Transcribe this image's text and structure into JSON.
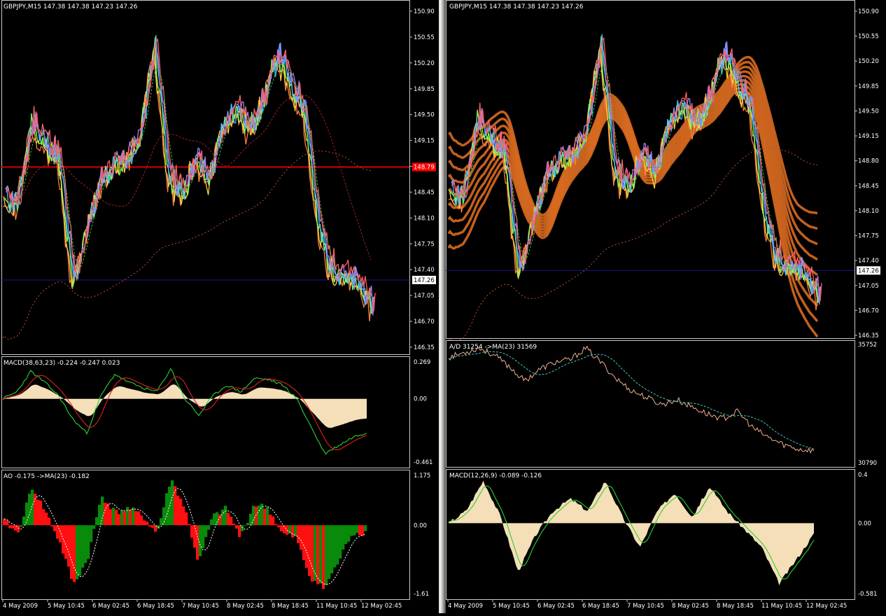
{
  "left": {
    "header": "GBPJPY,M15  147.38 147.38 147.23 147.26",
    "price_ticks": [
      "150.90",
      "150.55",
      "150.20",
      "149.85",
      "149.50",
      "149.15",
      "148.80",
      "148.45",
      "148.10",
      "147.75",
      "147.40",
      "147.05",
      "146.70",
      "146.35"
    ],
    "price_tag": "147.26",
    "level_tag": "148.79",
    "macd_header": "MACD(38,63,23) -0.224 -0.247 0.023",
    "macd_ticks": [
      "0.269",
      "0.00",
      "-0.461"
    ],
    "ao_header": "AO -0.175  ->MA(23) -0.182",
    "ao_ticks": [
      "1.175",
      "0.00",
      "-1.61"
    ],
    "time_ticks": [
      "4 May 2009",
      "5 May 10:45",
      "6 May 02:45",
      "6 May 18:45",
      "7 May 10:45",
      "8 May 02:45",
      "8 May 18:45",
      "11 May 10:45",
      "12 May 02:45"
    ]
  },
  "right": {
    "header": "GBPJPY,M15  147.38 147.38 147.23 147.26",
    "price_ticks": [
      "150.90",
      "150.55",
      "150.20",
      "149.85",
      "149.50",
      "149.15",
      "148.80",
      "148.45",
      "148.10",
      "147.75",
      "147.40",
      "147.05",
      "146.70",
      "146.35"
    ],
    "price_tag": "147.26",
    "ad_header": "A/D 31254  ->MA(23) 31569",
    "ad_ticks": [
      "35752",
      "30790"
    ],
    "macd_header": "MACD(12,26,9) -0.089 -0.126",
    "macd_ticks": [
      "0.4",
      "0.00",
      "-0.581"
    ],
    "time_ticks": [
      "4 May 2009",
      "5 May 10:45",
      "6 May 02:45",
      "6 May 18:45",
      "7 May 10:45",
      "8 May 02:45",
      "8 May 18:45",
      "11 May 10:45",
      "12 May 02:45"
    ]
  },
  "chart_data": [
    {
      "type": "line",
      "title": "GBPJPY,M15  147.38 147.38 147.23 147.26",
      "x": [
        "4 May 2009",
        "5 May 10:45",
        "6 May 02:45",
        "6 May 18:45",
        "7 May 10:45",
        "8 May 02:45",
        "8 May 18:45",
        "11 May 10:45",
        "12 May 02:45"
      ],
      "ylim": [
        146.35,
        150.9
      ],
      "series": [
        {
          "values": [
            148.35,
            148.3,
            149.4,
            149.1,
            148.9,
            147.2,
            147.9,
            148.6,
            148.8,
            148.9,
            149.2,
            150.5,
            148.7,
            148.4,
            148.9,
            148.6,
            149.3,
            149.6,
            149.3,
            149.7,
            150.3,
            149.9,
            149.6,
            148.0,
            147.4,
            147.3,
            147.2,
            146.9
          ]
        }
      ],
      "current_price": 147.26,
      "horizontal_level": 148.79
    },
    {
      "type": "line",
      "title": "MACD(38,63,23) -0.224 -0.247 0.023",
      "ylim": [
        -0.461,
        0.269
      ],
      "series": [
        {
          "values": [
            0.0,
            0.05,
            0.2,
            0.12,
            0.02,
            -0.15,
            -0.25,
            0.02,
            0.18,
            0.12,
            0.08,
            0.05,
            0.22,
            0.0,
            -0.12,
            0.02,
            0.1,
            0.05,
            0.15,
            0.14,
            0.1,
            0.0,
            -0.2,
            -0.4,
            -0.34,
            -0.28,
            -0.247
          ]
        }
      ]
    },
    {
      "type": "bar",
      "title": "AO -0.175  ->MA(23) -0.182",
      "ylim": [
        -1.61,
        1.175
      ],
      "series": [
        {
          "values": [
            0.1,
            -0.2,
            0.9,
            0.3,
            -0.4,
            -1.4,
            -0.8,
            0.7,
            0.3,
            0.4,
            0.2,
            -0.2,
            1.1,
            0.4,
            -0.9,
            0.2,
            0.4,
            -0.3,
            0.5,
            0.4,
            -0.2,
            -0.3,
            -1.2,
            -1.5,
            -0.9,
            -0.2,
            -0.175
          ]
        }
      ]
    },
    {
      "type": "line",
      "title": "A/D 31254  ->MA(23) 31569",
      "ylim": [
        30790,
        35752
      ],
      "series": [
        {
          "values": [
            35200,
            35400,
            35600,
            35300,
            34800,
            34200,
            34700,
            35000,
            35100,
            35600,
            35000,
            34300,
            33800,
            33500,
            33200,
            33400,
            33100,
            32800,
            32600,
            32900,
            32200,
            31800,
            31500,
            31300,
            31254
          ]
        }
      ]
    },
    {
      "type": "line",
      "title": "MACD(12,26,9) -0.089 -0.126",
      "ylim": [
        -0.581,
        0.4
      ],
      "series": [
        {
          "values": [
            0.0,
            0.1,
            0.35,
            0.05,
            -0.4,
            -0.1,
            0.1,
            0.2,
            0.1,
            0.35,
            0.05,
            -0.2,
            0.1,
            0.25,
            0.05,
            0.3,
            0.1,
            -0.05,
            -0.2,
            -0.5,
            -0.3,
            -0.089
          ]
        }
      ]
    }
  ]
}
